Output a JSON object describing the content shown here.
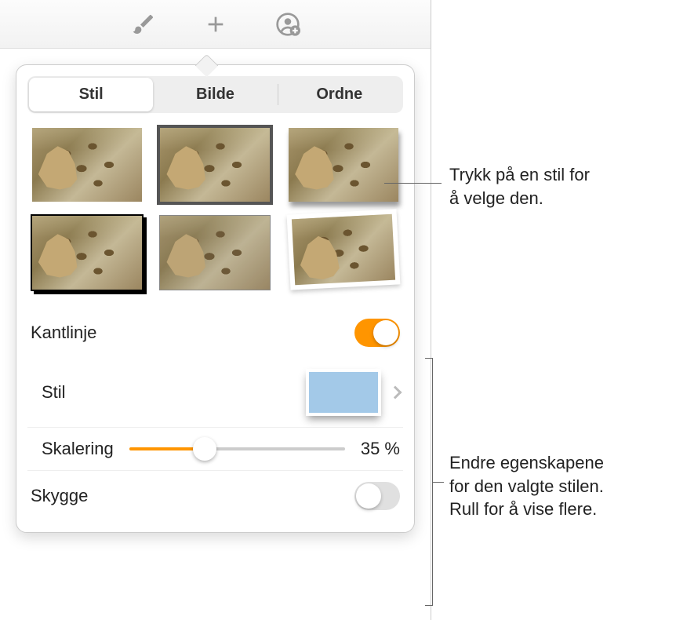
{
  "tabs": {
    "stil": "Stil",
    "bilde": "Bilde",
    "ordne": "Ordne"
  },
  "section_border": {
    "label": "Kantlinje"
  },
  "style_row": {
    "label": "Stil"
  },
  "scale_row": {
    "label": "Skalering",
    "value": "35 %",
    "percent": 35
  },
  "section_shadow": {
    "label": "Skygge"
  },
  "callouts": {
    "c1a": "Trykk på en stil for",
    "c1b": "å velge den.",
    "c2a": "Endre egenskapene",
    "c2b": "for den valgte stilen.",
    "c2c": "Rull for å vise flere."
  }
}
